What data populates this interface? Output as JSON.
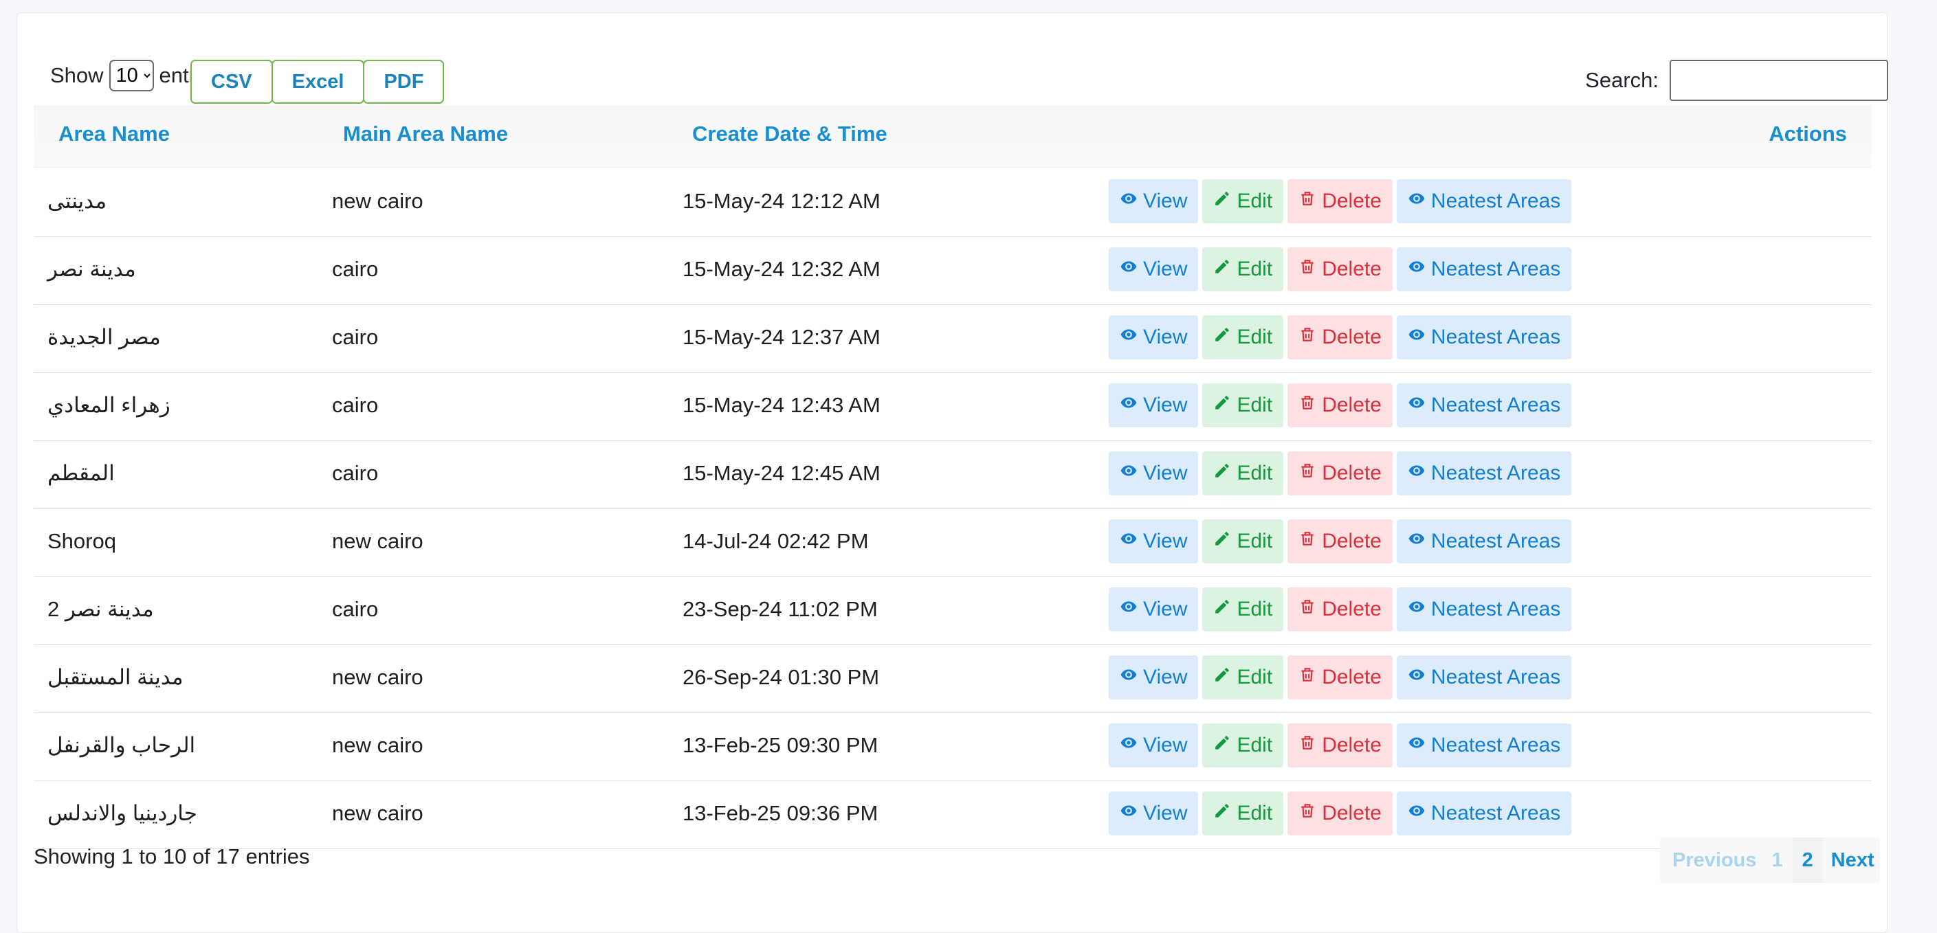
{
  "controls": {
    "show_label": "Show",
    "entries_label": "entries",
    "length_value": "10",
    "export": {
      "csv": "CSV",
      "excel": "Excel",
      "pdf": "PDF"
    },
    "search_label": "Search:",
    "search_value": ""
  },
  "table": {
    "headers": {
      "area_name": "Area Name",
      "main_area_name": "Main Area Name",
      "create_date": "Create Date & Time",
      "actions": "Actions"
    },
    "action_labels": {
      "view": "View",
      "edit": "Edit",
      "delete": "Delete",
      "nearest": "Neatest Areas"
    },
    "rows": [
      {
        "area": "مدينتى",
        "main": "new cairo",
        "date": "15-May-24 12:12 AM"
      },
      {
        "area": "مدينة نصر",
        "main": "cairo",
        "date": "15-May-24 12:32 AM"
      },
      {
        "area": "مصر الجديدة",
        "main": "cairo",
        "date": "15-May-24 12:37 AM"
      },
      {
        "area": "زهراء المعادي",
        "main": "cairo",
        "date": "15-May-24 12:43 AM"
      },
      {
        "area": "المقطم",
        "main": "cairo",
        "date": "15-May-24 12:45 AM"
      },
      {
        "area": "Shoroq",
        "main": "new cairo",
        "date": "14-Jul-24 02:42 PM"
      },
      {
        "area": "مدينة نصر 2",
        "main": "cairo",
        "date": "23-Sep-24 11:02 PM"
      },
      {
        "area": "مدينة المستقبل",
        "main": "new cairo",
        "date": "26-Sep-24 01:30 PM"
      },
      {
        "area": "الرحاب والقرنفل",
        "main": "new cairo",
        "date": "13-Feb-25 09:30 PM"
      },
      {
        "area": "جاردينيا والاندلس",
        "main": "new cairo",
        "date": "13-Feb-25 09:36 PM"
      }
    ]
  },
  "footer": {
    "info": "Showing 1 to 10 of 17 entries",
    "previous": "Previous",
    "page1": "1",
    "page2": "2",
    "next": "Next"
  },
  "colors": {
    "accent": "#168ecf",
    "view": "#137fd2",
    "edit": "#15993e",
    "delete": "#d8303d",
    "export_border": "#74b64a"
  }
}
